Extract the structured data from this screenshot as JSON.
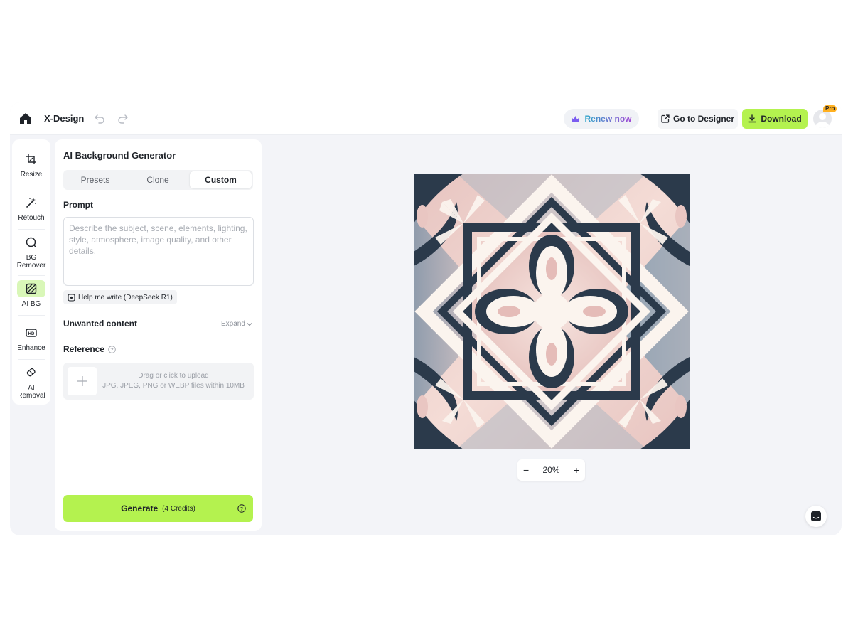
{
  "app": {
    "brand": "X-Design"
  },
  "topbar": {
    "renew_label": "Renew now",
    "designer_label": "Go to Designer",
    "download_label": "Download",
    "pro_badge": "Pro"
  },
  "rail": {
    "items": [
      {
        "label": "Resize",
        "icon": "crop-icon"
      },
      {
        "label": "Retouch",
        "icon": "magic-wand-icon"
      },
      {
        "label": "BG Remover",
        "icon": "bg-remover-icon"
      },
      {
        "label": "AI BG",
        "icon": "ai-bg-icon",
        "active": true
      },
      {
        "label": "Enhance",
        "icon": "hd-icon"
      },
      {
        "label": "AI Removal",
        "icon": "eraser-icon"
      }
    ]
  },
  "panel": {
    "title": "AI Background Generator",
    "tabs": [
      {
        "label": "Presets"
      },
      {
        "label": "Clone"
      },
      {
        "label": "Custom",
        "active": true
      }
    ],
    "prompt_label": "Prompt",
    "prompt_placeholder": "Describe the subject, scene, elements, lighting, style, atmosphere, image quality, and other details.",
    "help_write_label": "Help me write (DeepSeek R1)",
    "unwanted_label": "Unwanted content",
    "expand_label": "Expand",
    "reference_label": "Reference",
    "upload_line1": "Drag or click to upload",
    "upload_line2": "JPG, JPEG, PNG or WEBP files within 10MB",
    "generate_label": "Generate",
    "generate_credits": "(4 Credits)"
  },
  "canvas": {
    "zoom": "20%",
    "zoom_minus": "−",
    "zoom_plus": "+"
  },
  "colors": {
    "accent_green": "#b4f24f",
    "active_rail_bg": "#d9f7b8",
    "tile_navy": "#2b3a4b",
    "tile_pink": "#e9c6c2",
    "tile_blue_grey": "#8a9cad",
    "tile_cream": "#fbf4ee"
  }
}
